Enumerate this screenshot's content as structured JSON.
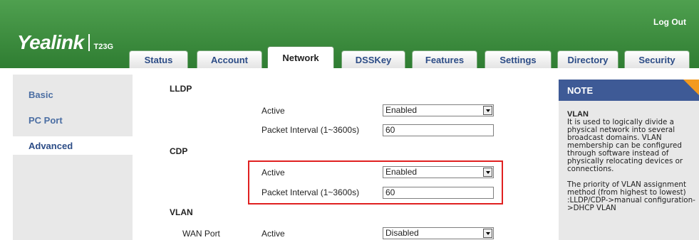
{
  "header": {
    "logo": "Yealink",
    "model": "T23G",
    "logout": "Log Out",
    "tabs": [
      "Status",
      "Account",
      "Network",
      "DSSKey",
      "Features",
      "Settings",
      "Directory",
      "Security"
    ],
    "active_tab": "Network"
  },
  "sidebar": {
    "items": [
      "Basic",
      "PC Port",
      "Advanced"
    ],
    "active": "Advanced"
  },
  "main": {
    "lldp": {
      "title": "LLDP",
      "active_label": "Active",
      "active_value": "Enabled",
      "interval_label": "Packet Interval (1~3600s)",
      "interval_value": "60"
    },
    "cdp": {
      "title": "CDP",
      "active_label": "Active",
      "active_value": "Enabled",
      "interval_label": "Packet Interval (1~3600s)",
      "interval_value": "60"
    },
    "vlan": {
      "title": "VLAN",
      "wan_label": "WAN Port",
      "active_label": "Active",
      "active_value": "Disabled"
    }
  },
  "note": {
    "title": "NOTE",
    "vlan_heading": "VLAN",
    "para1": "It is used to logically divide a physical network into several broadcast domains. VLAN membership can be configured through software instead of physically relocating devices or connections.",
    "para2": "The priority of VLAN assignment method (from highest to lowest) :LLDP/CDP->manual configuration->DHCP VLAN"
  },
  "colors": {
    "header_green": "#2f7d32",
    "note_blue": "#3e5a96",
    "note_corner": "#f39a1e",
    "highlight_red": "#e02020",
    "nav_blue": "#4b6ea3"
  }
}
